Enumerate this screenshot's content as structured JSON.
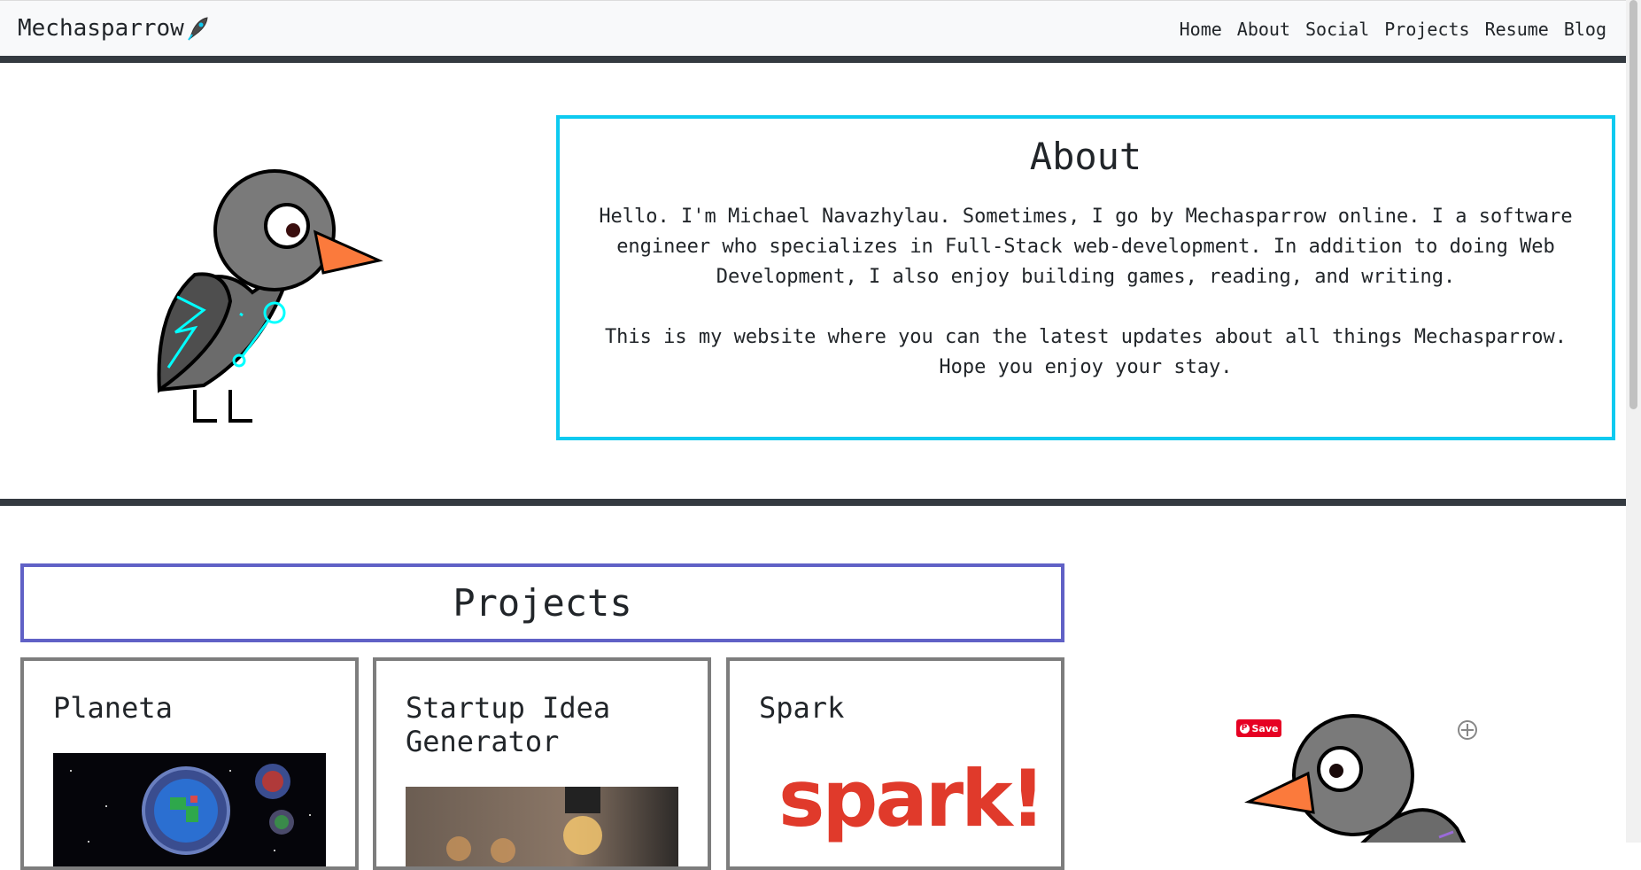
{
  "navbar": {
    "brand": "Mechasparrow",
    "brand_icon": "rocket-icon",
    "links": [
      "Home",
      "About",
      "Social",
      "Projects",
      "Resume",
      "Blog"
    ]
  },
  "about": {
    "title": "About",
    "paragraph1": "Hello. I'm Michael Navazhylau. Sometimes, I go by Mechasparrow online. I a software engineer who specializes in Full-Stack web-development. In addition to doing Web Development, I also enjoy building games, reading, and writing.",
    "paragraph2": "This is my website where you can the latest updates about all things Mechasparrow. Hope you enjoy your stay."
  },
  "projects": {
    "title": "Projects",
    "cards": [
      {
        "title": "Planeta"
      },
      {
        "title": "Startup Idea Generator"
      },
      {
        "title": "Spark",
        "logo_text": "spark!"
      }
    ]
  },
  "pinterest": {
    "save_label": "Save"
  },
  "colors": {
    "about_border": "#0dcaf0",
    "projects_border": "#6061c6",
    "card_border": "#7d7d7d",
    "dark_bar": "#343a40",
    "spark_red": "#e03a2b"
  }
}
